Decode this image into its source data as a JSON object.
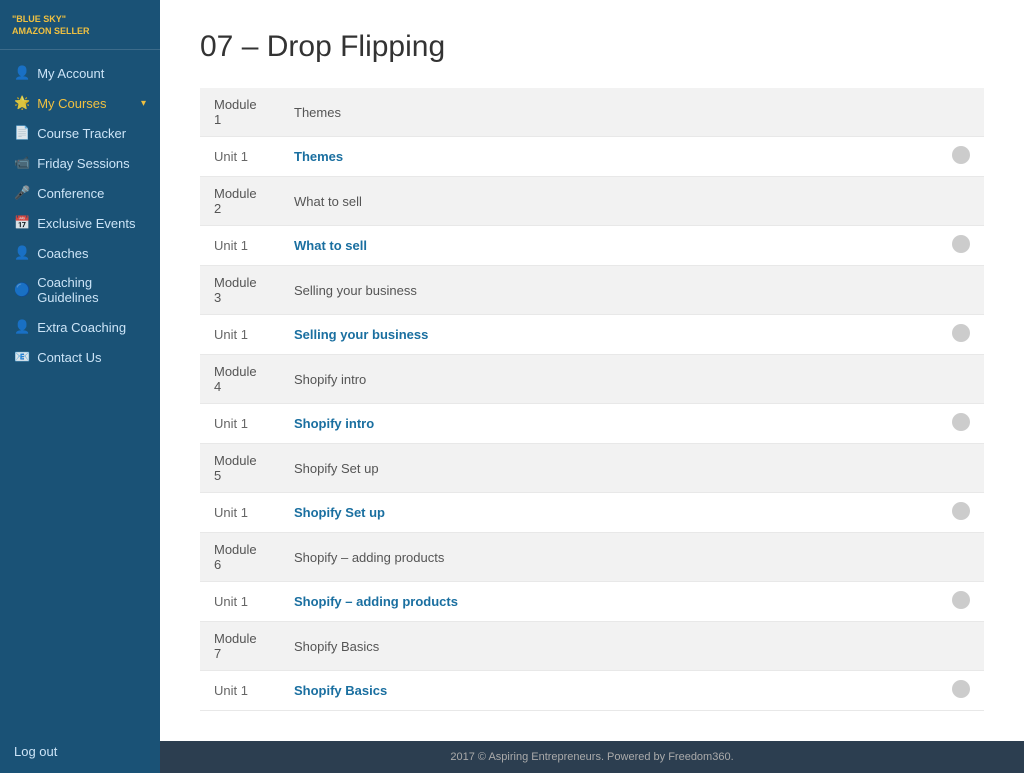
{
  "logo": {
    "line1": "\"BLUE SKY\"",
    "line2": "AMAZON SELLER"
  },
  "sidebar": {
    "items": [
      {
        "id": "my-account",
        "label": "My Account",
        "icon": "👤",
        "active": false
      },
      {
        "id": "my-courses",
        "label": "My Courses",
        "icon": "🌟",
        "active": true,
        "hasChevron": true
      },
      {
        "id": "course-tracker",
        "label": "Course Tracker",
        "icon": "📄",
        "active": false
      },
      {
        "id": "friday-sessions",
        "label": "Friday Sessions",
        "icon": "📹",
        "active": false
      },
      {
        "id": "conference",
        "label": "Conference",
        "icon": "🎤",
        "active": false
      },
      {
        "id": "exclusive-events",
        "label": "Exclusive Events",
        "icon": "📅",
        "active": false
      },
      {
        "id": "coaches",
        "label": "Coaches",
        "icon": "👤",
        "active": false
      },
      {
        "id": "coaching-guidelines",
        "label": "Coaching Guidelines",
        "icon": "🔵",
        "active": false
      },
      {
        "id": "extra-coaching",
        "label": "Extra Coaching",
        "icon": "👤",
        "active": false
      },
      {
        "id": "contact-us",
        "label": "Contact Us",
        "icon": "📧",
        "active": false
      }
    ],
    "logout_label": "Log out"
  },
  "page": {
    "title": "07 – Drop Flipping"
  },
  "course_modules": [
    {
      "module_label": "Module 1",
      "module_name": "Themes",
      "units": [
        {
          "unit_label": "Unit 1",
          "unit_name": "Themes",
          "link": true
        }
      ]
    },
    {
      "module_label": "Module 2",
      "module_name": "What to sell",
      "units": [
        {
          "unit_label": "Unit 1",
          "unit_name": "What to sell",
          "link": true
        }
      ]
    },
    {
      "module_label": "Module 3",
      "module_name": "Selling your business",
      "units": [
        {
          "unit_label": "Unit 1",
          "unit_name": "Selling your business",
          "link": true
        }
      ]
    },
    {
      "module_label": "Module 4",
      "module_name": "Shopify intro",
      "units": [
        {
          "unit_label": "Unit 1",
          "unit_name": "Shopify intro",
          "link": true
        }
      ]
    },
    {
      "module_label": "Module 5",
      "module_name": "Shopify Set up",
      "units": [
        {
          "unit_label": "Unit 1",
          "unit_name": "Shopify Set up",
          "link": true
        }
      ]
    },
    {
      "module_label": "Module 6",
      "module_name": "Shopify – adding products",
      "units": [
        {
          "unit_label": "Unit 1",
          "unit_name": "Shopify – adding products",
          "link": true
        }
      ]
    },
    {
      "module_label": "Module 7",
      "module_name": "Shopify Basics",
      "units": [
        {
          "unit_label": "Unit 1",
          "unit_name": "Shopify Basics",
          "link": true
        }
      ]
    }
  ],
  "footer": {
    "text": "2017 © Aspiring Entrepreneurs. Powered by Freedom360."
  }
}
